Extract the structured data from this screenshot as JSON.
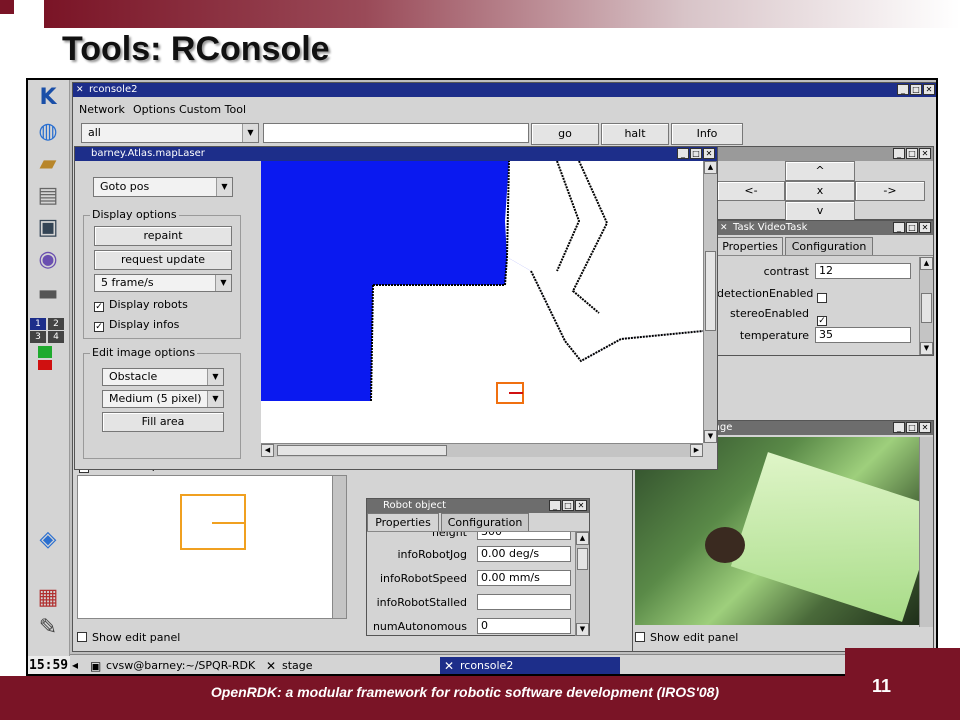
{
  "slide": {
    "title": "Tools: RConsole",
    "footer": "OpenRDK: a modular framework for robotic software development (IROS'08)",
    "page_number": "11",
    "colors": {
      "accent": "#7a1426",
      "titlebar_active": "#1d2e8a",
      "map_blue": "#0a19f0"
    }
  },
  "dock": {
    "icons": [
      "kde-icon",
      "globe-icon",
      "folder-icon",
      "document-icon",
      "monitor-icon",
      "cd-icon",
      "printer-icon"
    ],
    "pager": [
      "1",
      "2",
      "3",
      "4"
    ],
    "clock": "15:59"
  },
  "taskbar": {
    "tasks": [
      {
        "label": "cvsw@barney:~/SPQR-RDK",
        "icon": "terminal-icon"
      },
      {
        "label": "stage",
        "icon": "x-icon"
      },
      {
        "label": "rconsole2",
        "icon": "x-icon"
      }
    ]
  },
  "rconsole": {
    "title": "rconsole2",
    "menu": [
      "Network",
      "Options",
      "Custom Tool"
    ],
    "selector": "all",
    "command": "",
    "buttons": [
      "go",
      "halt",
      "Info"
    ],
    "show_edit_panel": "Show edit panel"
  },
  "joystick": {
    "up": "^",
    "left": "<-",
    "center": "x",
    "right": "->",
    "down": "v"
  },
  "map_laser": {
    "title": "barney.Atlas.mapLaser",
    "mode": "Goto pos",
    "display_options": {
      "label": "Display options",
      "repaint": "repaint",
      "request_update": "request update",
      "rate": "5 frame/s",
      "display_robots": "Display robots",
      "display_infos": "Display infos"
    },
    "edit_options": {
      "label": "Edit image options",
      "type": "Obstacle",
      "pen": "Medium (5 pixel)",
      "fill_area": "Fill area"
    }
  },
  "video_task": {
    "title": "Task VideoTask",
    "tabs": [
      "Properties",
      "Configuration"
    ],
    "properties": [
      {
        "name": "contrast",
        "value": "12",
        "kind": "text"
      },
      {
        "name": "detectionEnabled",
        "value": "",
        "kind": "check-off"
      },
      {
        "name": "stereoEnabled",
        "value": "✓",
        "kind": "check-on"
      },
      {
        "name": "temperature",
        "value": "35",
        "kind": "text"
      }
    ]
  },
  "video_image": {
    "title": "Task.videoImage",
    "show_edit_panel": "Show edit panel"
  },
  "robot_object": {
    "title": "Robot object",
    "tabs": [
      "Properties",
      "Configuration"
    ],
    "properties": [
      {
        "name": "height",
        "value": "300"
      },
      {
        "name": "infoRobotJog",
        "value": "0.00 deg/s"
      },
      {
        "name": "infoRobotSpeed",
        "value": "0.00 mm/s"
      },
      {
        "name": "infoRobotStalled",
        "value": ""
      },
      {
        "name": "numAutonomous",
        "value": "0"
      }
    ]
  }
}
